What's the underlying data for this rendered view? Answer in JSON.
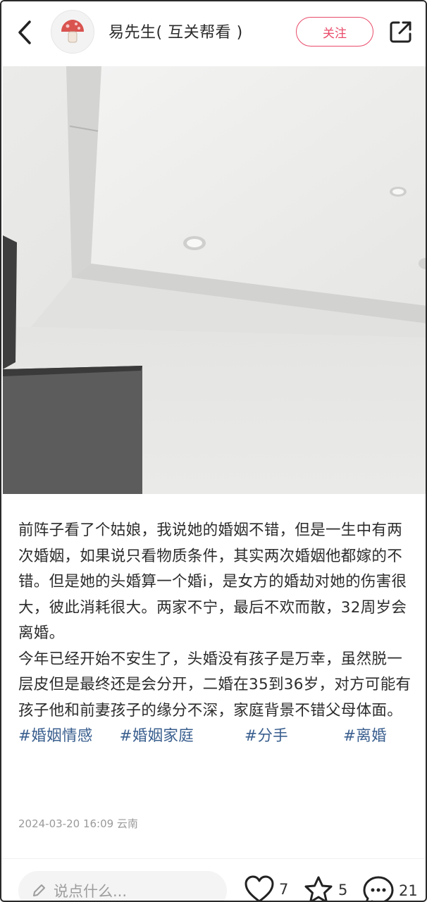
{
  "header": {
    "username": "易先生( 互关帮看 )",
    "follow_label": "关注"
  },
  "post": {
    "paragraph1": "前阵子看了个姑娘，我说她的婚姻不错，但是一生中有两次婚姻，如果说只看物质条件，其实两次婚姻他都嫁的不错。但是她的头婚算一个婚i，是女方的婚劫对她的伤害很大，彼此消耗很大。两家不宁，最后不欢而散，32周岁会离婚。",
    "paragraph2": "今年已经开始不安生了，头婚没有孩子是万幸，虽然脱一层皮但是最终还是会分开，二婚在35到36岁，对方可能有孩子他和前妻孩子的缘分不深，家庭背景不错父母体面。",
    "tags": [
      "#婚姻情感",
      "#婚姻家庭",
      "#分手",
      "#离婚"
    ],
    "meta": "2024-03-20 16:09 云南"
  },
  "bottom_bar": {
    "comment_placeholder": "说点什么...",
    "like_count": "7",
    "collect_count": "5",
    "comment_count": "21"
  },
  "colors": {
    "accent": "#e94b6a",
    "tag": "#3a5f8f",
    "meta": "#9a9a9a"
  },
  "icons": {
    "back": "chevron-left-icon",
    "avatar": "mushroom-icon",
    "share": "share-icon",
    "edit": "pencil-icon",
    "like": "heart-icon",
    "collect": "star-icon",
    "comment": "chat-bubble-icon"
  }
}
